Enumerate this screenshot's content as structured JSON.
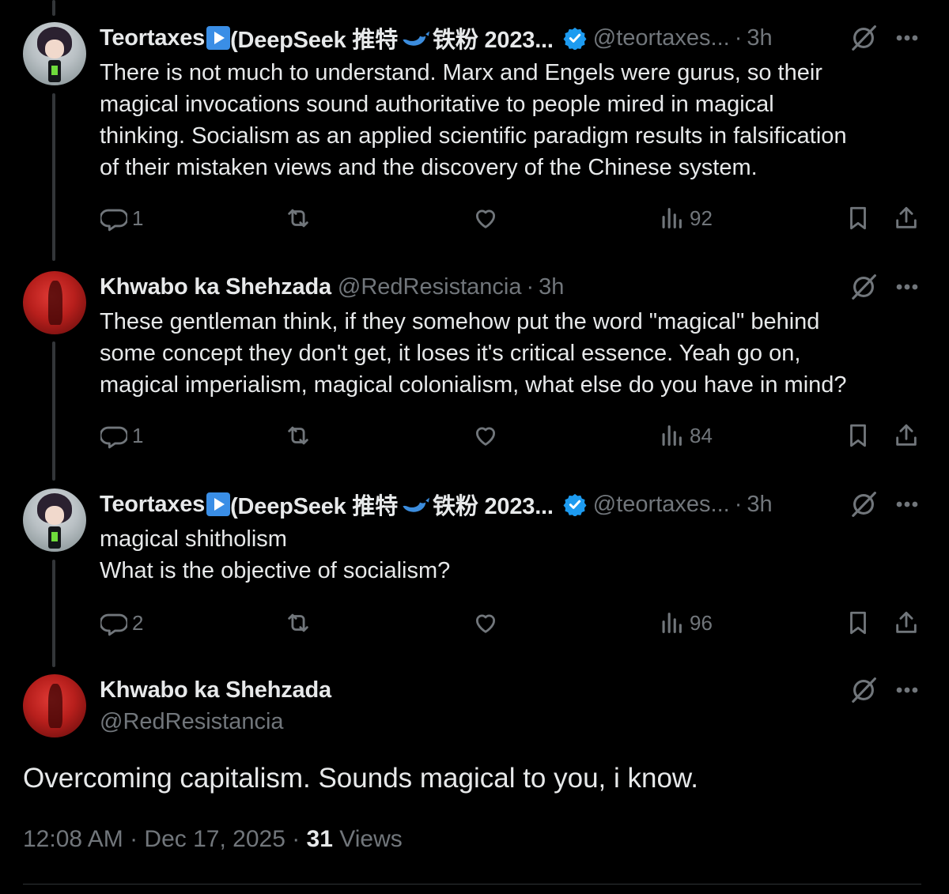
{
  "tweets": [
    {
      "author": "Teortaxes",
      "author_suffix_pre": " (DeepSeek 推特",
      "author_suffix_post": "铁粉 2023...",
      "handle": "@teortaxes...",
      "time": "3h",
      "text": "There is not much to understand. Marx and Engels were gurus, so their\nmagical invocations sound authoritative to people mired in magical\nthinking. Socialism as an applied scientific paradigm results in falsification\nof their mistaken views and the discovery of the Chinese system.",
      "replies": "1",
      "views": "92"
    },
    {
      "author": "Khwabo ka Shehzada",
      "handle": "@RedResistancia",
      "time": "3h",
      "text": "These gentleman think, if they somehow put the word \"magical\" behind\nsome concept they don't get, it loses it's critical essence. Yeah go on,\nmagical imperialism, magical colonialism, what else do you have in mind?",
      "replies": "1",
      "views": "84"
    },
    {
      "author": "Teortaxes",
      "author_suffix_pre": " (DeepSeek 推特",
      "author_suffix_post": "铁粉 2023...",
      "handle": "@teortaxes...",
      "time": "3h",
      "text": "magical shitholism\nWhat is the objective of socialism?",
      "replies": "2",
      "views": "96"
    }
  ],
  "main": {
    "author": "Khwabo ka Shehzada",
    "handle": "@RedResistancia",
    "text": "Overcoming capitalism. Sounds magical to you, i know.",
    "timestamp": "12:08 AM · Dec 17, 2025 · ",
    "views_count": "31",
    "views_label": " Views"
  },
  "separator": "·",
  "colors": {
    "background": "#000000",
    "text": "#e7e9ea",
    "muted": "#71767b",
    "verified": "#1d9bf0",
    "thread_line": "#333639"
  },
  "icons": [
    "reply-icon",
    "retweet-icon",
    "like-icon",
    "views-icon",
    "bookmark-icon",
    "share-icon",
    "grok-icon",
    "more-icon",
    "verified-icon"
  ]
}
